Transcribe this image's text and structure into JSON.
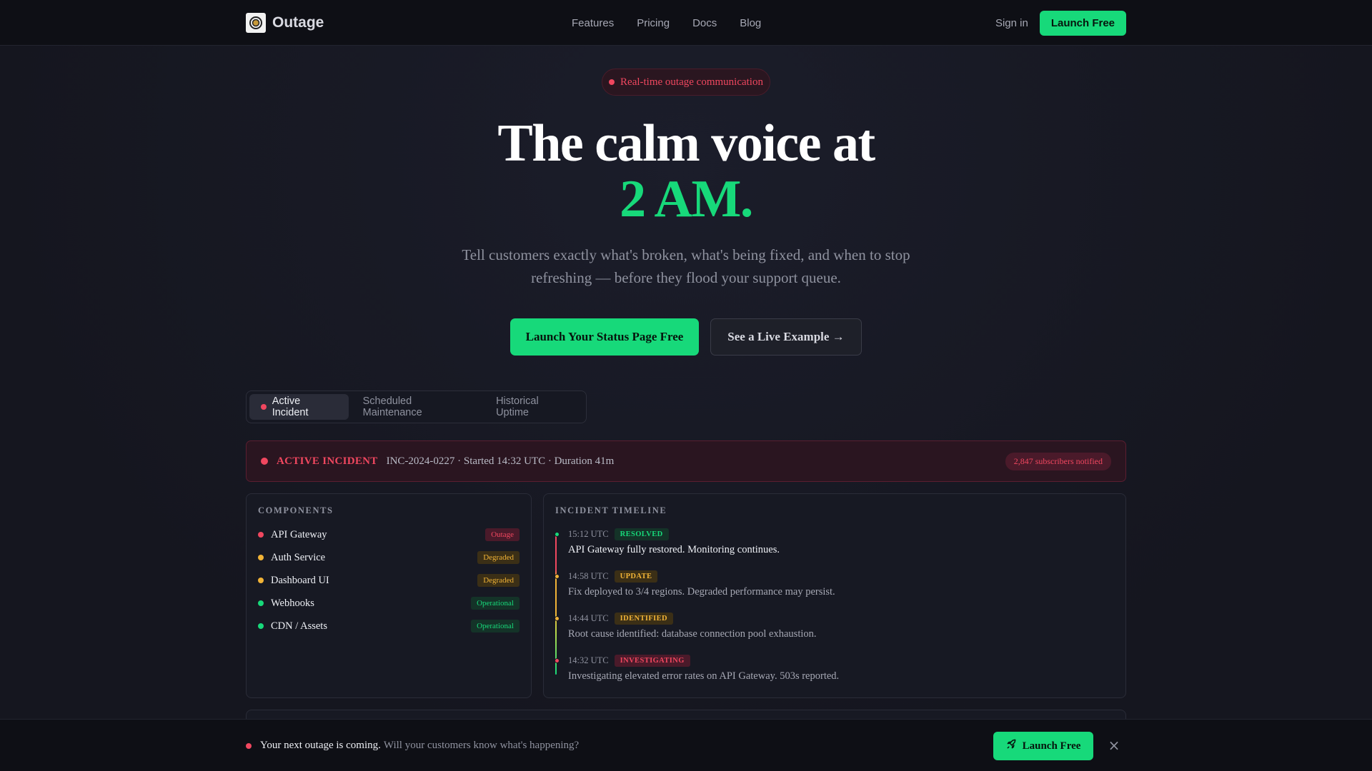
{
  "nav": {
    "brand": "Outage",
    "links": [
      "Features",
      "Pricing",
      "Docs",
      "Blog"
    ],
    "signin": "Sign in",
    "cta": "Launch Free"
  },
  "hero": {
    "pill": "Real-time outage communication",
    "headline_line1": "The calm voice at",
    "headline_line2": "2 AM.",
    "subtitle": "Tell customers exactly what's broken, what's being fixed, and when to stop refreshing — before they flood your support queue.",
    "primary_cta": "Launch Your Status Page Free",
    "secondary_cta": "See a Live Example →"
  },
  "tabs": [
    {
      "label": "Active Incident",
      "active": true
    },
    {
      "label": "Scheduled Maintenance",
      "active": false
    },
    {
      "label": "Historical Uptime",
      "active": false
    }
  ],
  "incident": {
    "title": "ACTIVE INCIDENT",
    "meta": "INC-2024-0227 · Started 14:32 UTC · Duration 41m",
    "subscribers": "2,847 subscribers notified"
  },
  "components": {
    "title": "COMPONENTS",
    "items": [
      {
        "name": "API Gateway",
        "status": "Outage"
      },
      {
        "name": "Auth Service",
        "status": "Degraded"
      },
      {
        "name": "Dashboard UI",
        "status": "Degraded"
      },
      {
        "name": "Webhooks",
        "status": "Operational"
      },
      {
        "name": "CDN / Assets",
        "status": "Operational"
      }
    ]
  },
  "timeline": {
    "title": "INCIDENT TIMELINE",
    "items": [
      {
        "time": "15:12 UTC",
        "badge": "RESOLVED",
        "text": "API Gateway fully restored. Monitoring continues."
      },
      {
        "time": "14:58 UTC",
        "badge": "UPDATE",
        "text": "Fix deployed to 3/4 regions. Degraded performance may persist."
      },
      {
        "time": "14:44 UTC",
        "badge": "IDENTIFIED",
        "text": "Root cause identified: database connection pool exhaustion."
      },
      {
        "time": "14:32 UTC",
        "badge": "INVESTIGATING",
        "text": "Investigating elevated error rates on API Gateway. 503s reported."
      }
    ]
  },
  "bottom_bar": {
    "strong": "Your next outage is coming.",
    "muted": "Will your customers know what's happening?",
    "cta": "Launch Free"
  },
  "colors": {
    "accent": "#17d97a",
    "danger": "#f0475f",
    "warning": "#f1b336",
    "background": "#15161f"
  },
  "icons": {
    "logo": "outage-logo-icon",
    "bottom_cta": "rocket-icon",
    "close": "close-icon"
  }
}
